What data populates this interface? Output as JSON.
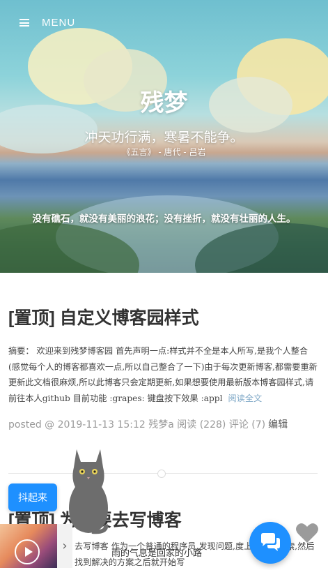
{
  "header": {
    "menu_label": "MENU",
    "site_title": "残梦",
    "poem_line": "冲天功行满，寒暑不能争。",
    "poem_source": "《五言》 - 唐代 - 吕岩",
    "motto": "没有礁石，就没有美丽的浪花；没有挫折，就没有壮丽的人生。"
  },
  "posts": [
    {
      "title": "[置顶] 自定义博客园样式",
      "summary": "摘要： 欢迎来到残梦博客园 首先声明一点:样式并不全是本人所写,是我个人整合(感觉每个人的博客都喜欢一点,所以自己整合了一下)由于每次更新博客,都需要重新更新此文档很麻烦,所以此博客只会定期更新,如果想要使用最新版本博客园样式,请前往本人github 目前功能 :grapes: 键盘按下效果 :appl",
      "read_more": "阅读全文",
      "meta": "posted @ 2019-11-13 15:12 残梦a 阅读 (228) 评论 (7)",
      "edit": "编辑"
    },
    {
      "title": "[置顶] 为何要去写博客",
      "summary": "去写博客 作为一个普通的程序员,发现问题,度上直接去搜索,然后找到解决的方案之后就开始写"
    }
  ],
  "widgets": {
    "back_to_top": "抖起来",
    "song_title": "雨的气息是回家的小路",
    "player_toggle": "›"
  },
  "colors": {
    "accent": "#1e90ff",
    "read_more": "#7fa8c7"
  }
}
